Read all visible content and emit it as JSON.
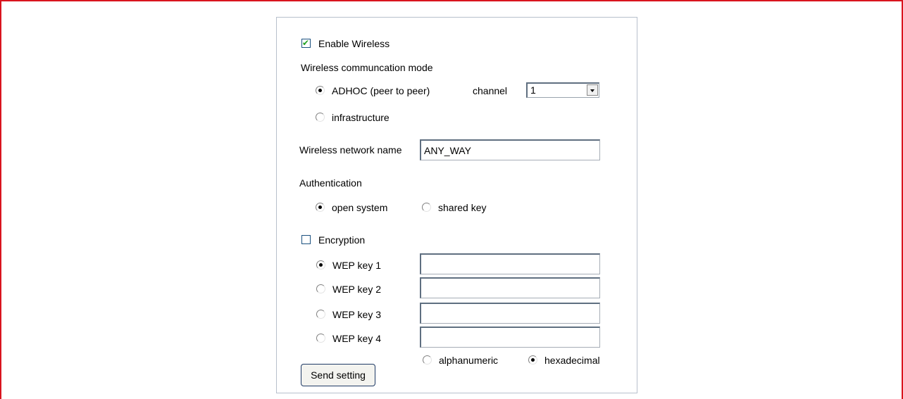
{
  "wireless": {
    "enable_label": "Enable Wireless",
    "enable_checked": true,
    "mode_title": "Wireless communcation mode",
    "mode_adhoc_label": "ADHOC (peer to peer)",
    "mode_infra_label": "infrastructure",
    "mode_selected": "adhoc",
    "channel_label": "channel",
    "channel_value": "1",
    "network_name_label": "Wireless network name",
    "network_name_value": "ANY_WAY"
  },
  "authentication": {
    "title": "Authentication",
    "open_label": "open system",
    "shared_label": "shared key",
    "selected": "open"
  },
  "encryption": {
    "label": "Encryption",
    "checked": false,
    "selected_key": 1,
    "keys": [
      {
        "label": "WEP key 1",
        "value": ""
      },
      {
        "label": "WEP key 2",
        "value": ""
      },
      {
        "label": "WEP key 3",
        "value": ""
      },
      {
        "label": "WEP key 4",
        "value": ""
      }
    ],
    "format_alpha_label": "alphanumeric",
    "format_hex_label": "hexadecimal",
    "format_selected": "hex"
  },
  "actions": {
    "send_label": "Send setting"
  },
  "colors": {
    "frame_border": "#d9141e",
    "panel_border": "#b7c0cc",
    "button_border": "#1f3a66"
  }
}
